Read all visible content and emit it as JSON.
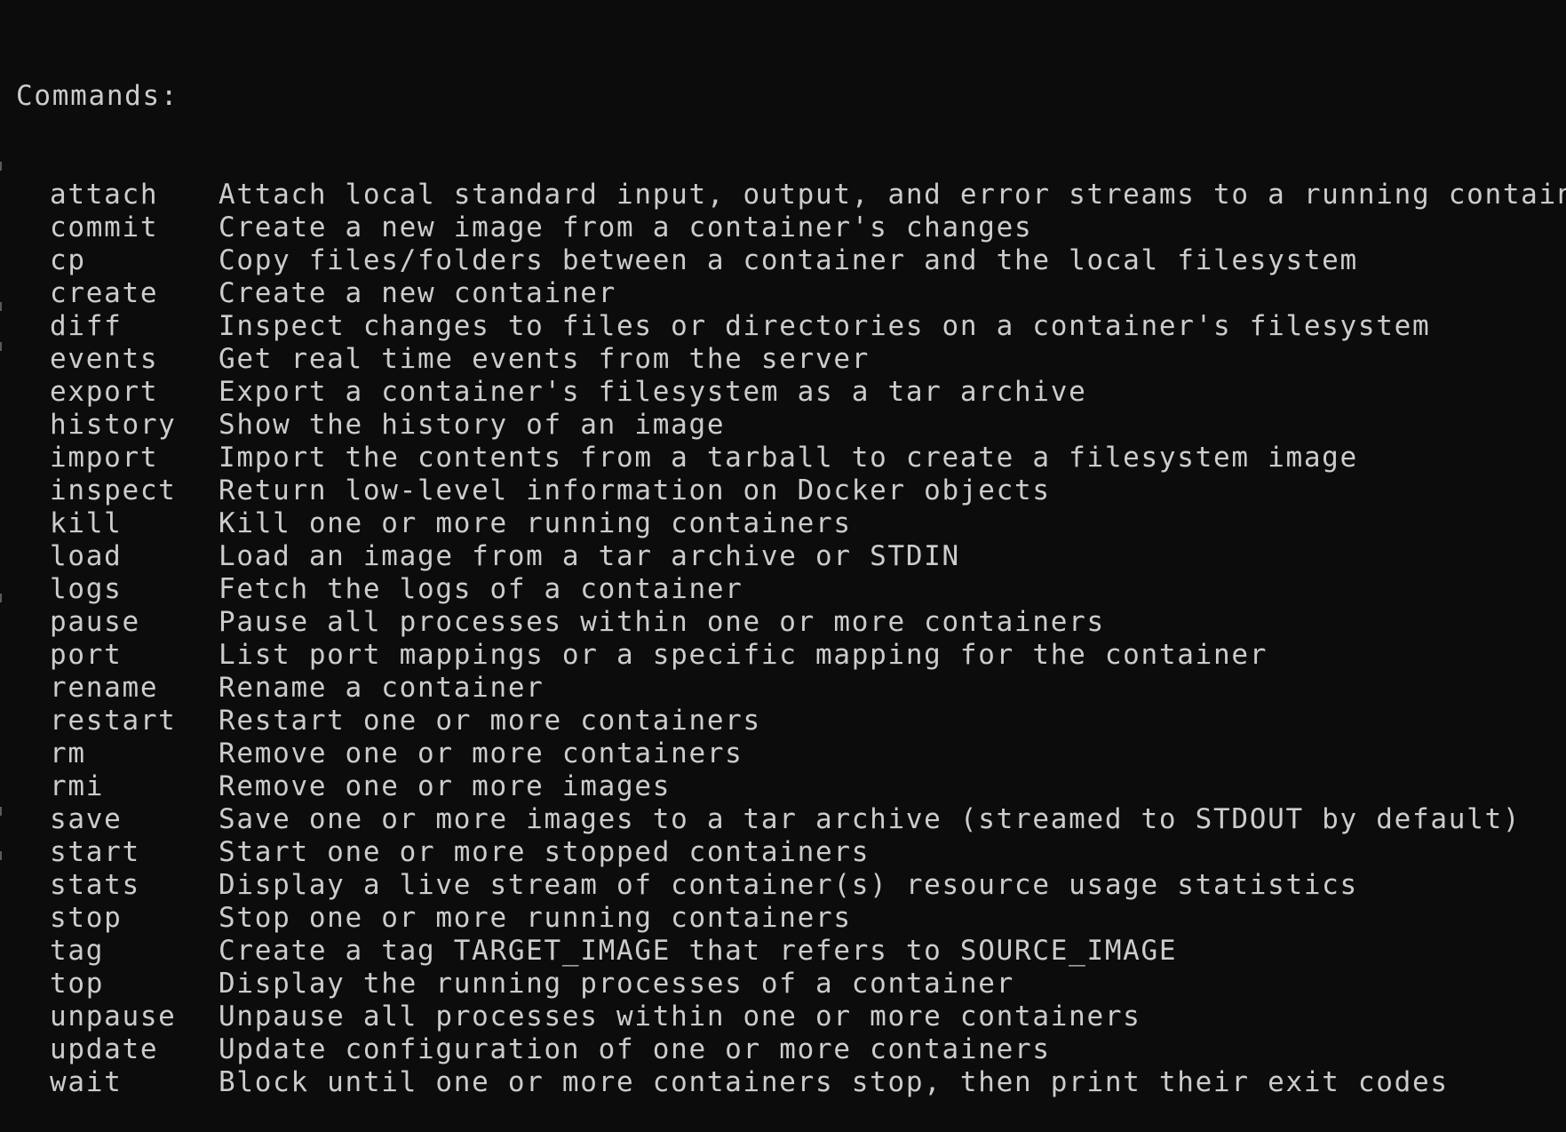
{
  "terminal": {
    "heading": "Commands:",
    "commands": [
      {
        "name": "attach",
        "description": "Attach local standard input, output, and error streams to a running container"
      },
      {
        "name": "commit",
        "description": "Create a new image from a container's changes"
      },
      {
        "name": "cp",
        "description": "Copy files/folders between a container and the local filesystem"
      },
      {
        "name": "create",
        "description": "Create a new container"
      },
      {
        "name": "diff",
        "description": "Inspect changes to files or directories on a container's filesystem"
      },
      {
        "name": "events",
        "description": "Get real time events from the server"
      },
      {
        "name": "export",
        "description": "Export a container's filesystem as a tar archive"
      },
      {
        "name": "history",
        "description": "Show the history of an image"
      },
      {
        "name": "import",
        "description": "Import the contents from a tarball to create a filesystem image"
      },
      {
        "name": "inspect",
        "description": "Return low-level information on Docker objects"
      },
      {
        "name": "kill",
        "description": "Kill one or more running containers"
      },
      {
        "name": "load",
        "description": "Load an image from a tar archive or STDIN"
      },
      {
        "name": "logs",
        "description": "Fetch the logs of a container"
      },
      {
        "name": "pause",
        "description": "Pause all processes within one or more containers"
      },
      {
        "name": "port",
        "description": "List port mappings or a specific mapping for the container"
      },
      {
        "name": "rename",
        "description": "Rename a container"
      },
      {
        "name": "restart",
        "description": "Restart one or more containers"
      },
      {
        "name": "rm",
        "description": "Remove one or more containers"
      },
      {
        "name": "rmi",
        "description": "Remove one or more images"
      },
      {
        "name": "save",
        "description": "Save one or more images to a tar archive (streamed to STDOUT by default)"
      },
      {
        "name": "start",
        "description": "Start one or more stopped containers"
      },
      {
        "name": "stats",
        "description": "Display a live stream of container(s) resource usage statistics"
      },
      {
        "name": "stop",
        "description": "Stop one or more running containers"
      },
      {
        "name": "tag",
        "description": "Create a tag TARGET_IMAGE that refers to SOURCE_IMAGE"
      },
      {
        "name": "top",
        "description": "Display the running processes of a container"
      },
      {
        "name": "unpause",
        "description": "Unpause all processes within one or more containers"
      },
      {
        "name": "update",
        "description": "Update configuration of one or more containers"
      },
      {
        "name": "wait",
        "description": "Block until one or more containers stop, then print their exit codes"
      }
    ]
  },
  "colors": {
    "background": "#0c0c0c",
    "foreground": "#cccccc"
  }
}
